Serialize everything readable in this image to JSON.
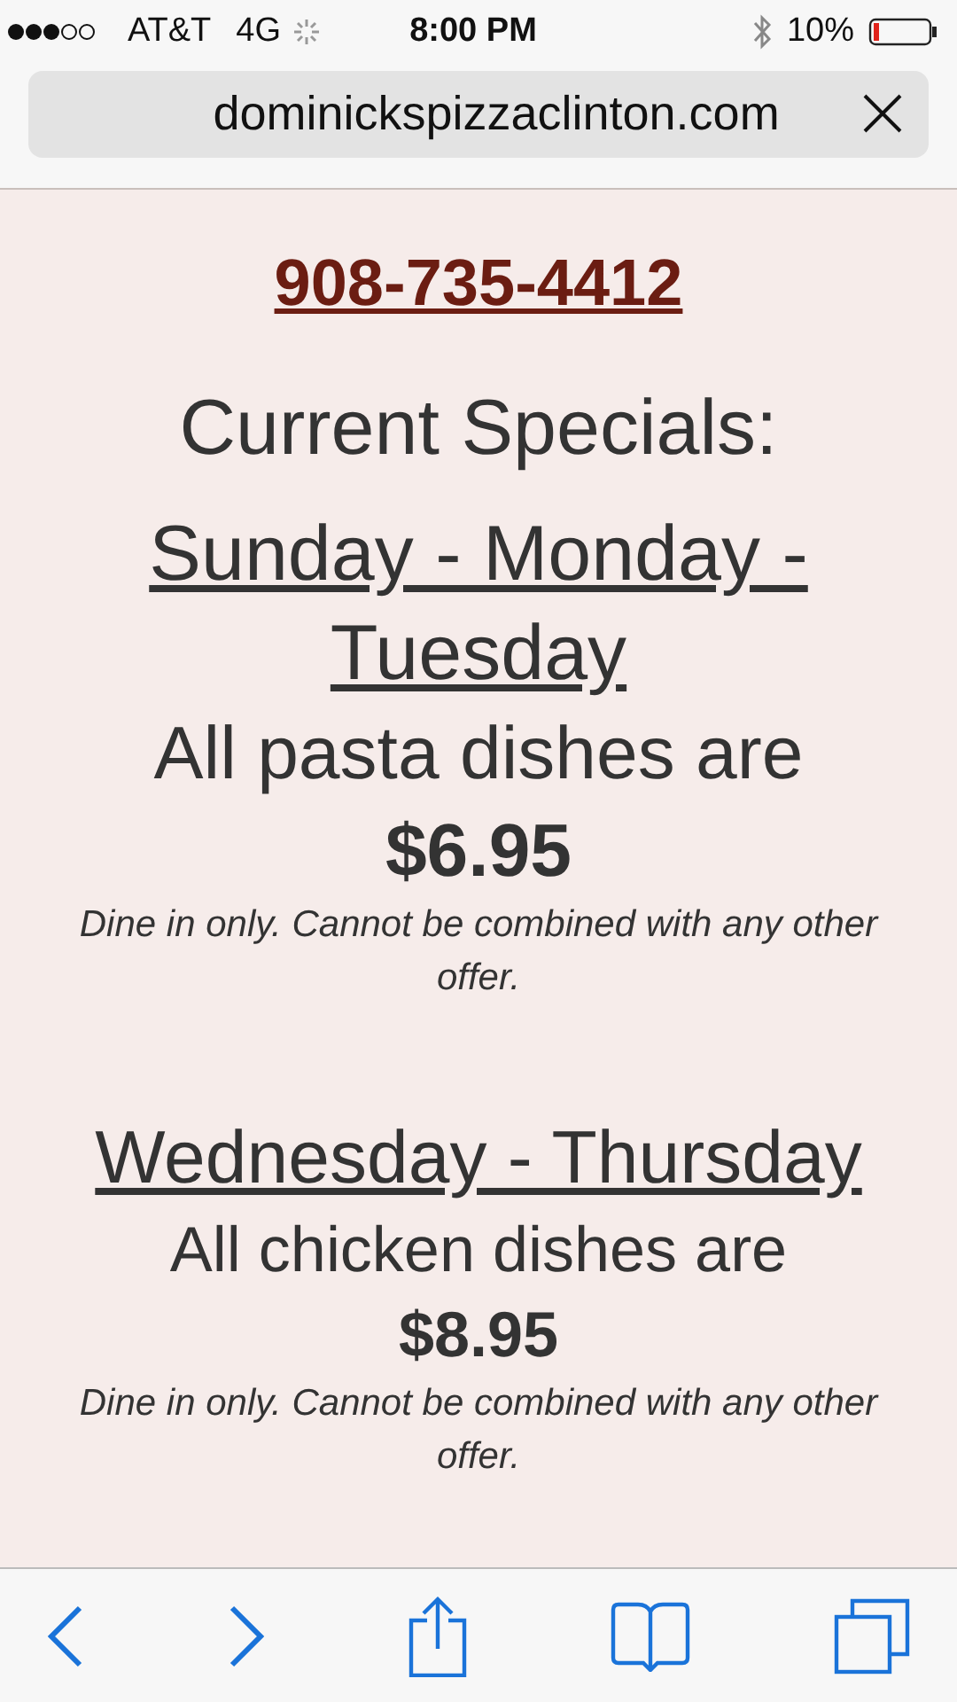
{
  "status_bar": {
    "carrier": "AT&T",
    "network": "4G",
    "time": "8:00 PM",
    "battery": "10%"
  },
  "address_bar": {
    "url": "dominickspizzaclinton.com"
  },
  "page": {
    "phone": "908-735-4412",
    "title": "Current Specials:",
    "specials": [
      {
        "days": "Sunday - Monday - Tuesday",
        "offer": "All pasta dishes are",
        "price": "$6.95",
        "note": "Dine in only. Cannot be combined with any other offer."
      },
      {
        "days": "Wednesday - Thursday",
        "offer": "All chicken dishes are",
        "price": "$8.95",
        "note": "Dine in only. Cannot be combined with any other offer."
      }
    ]
  }
}
